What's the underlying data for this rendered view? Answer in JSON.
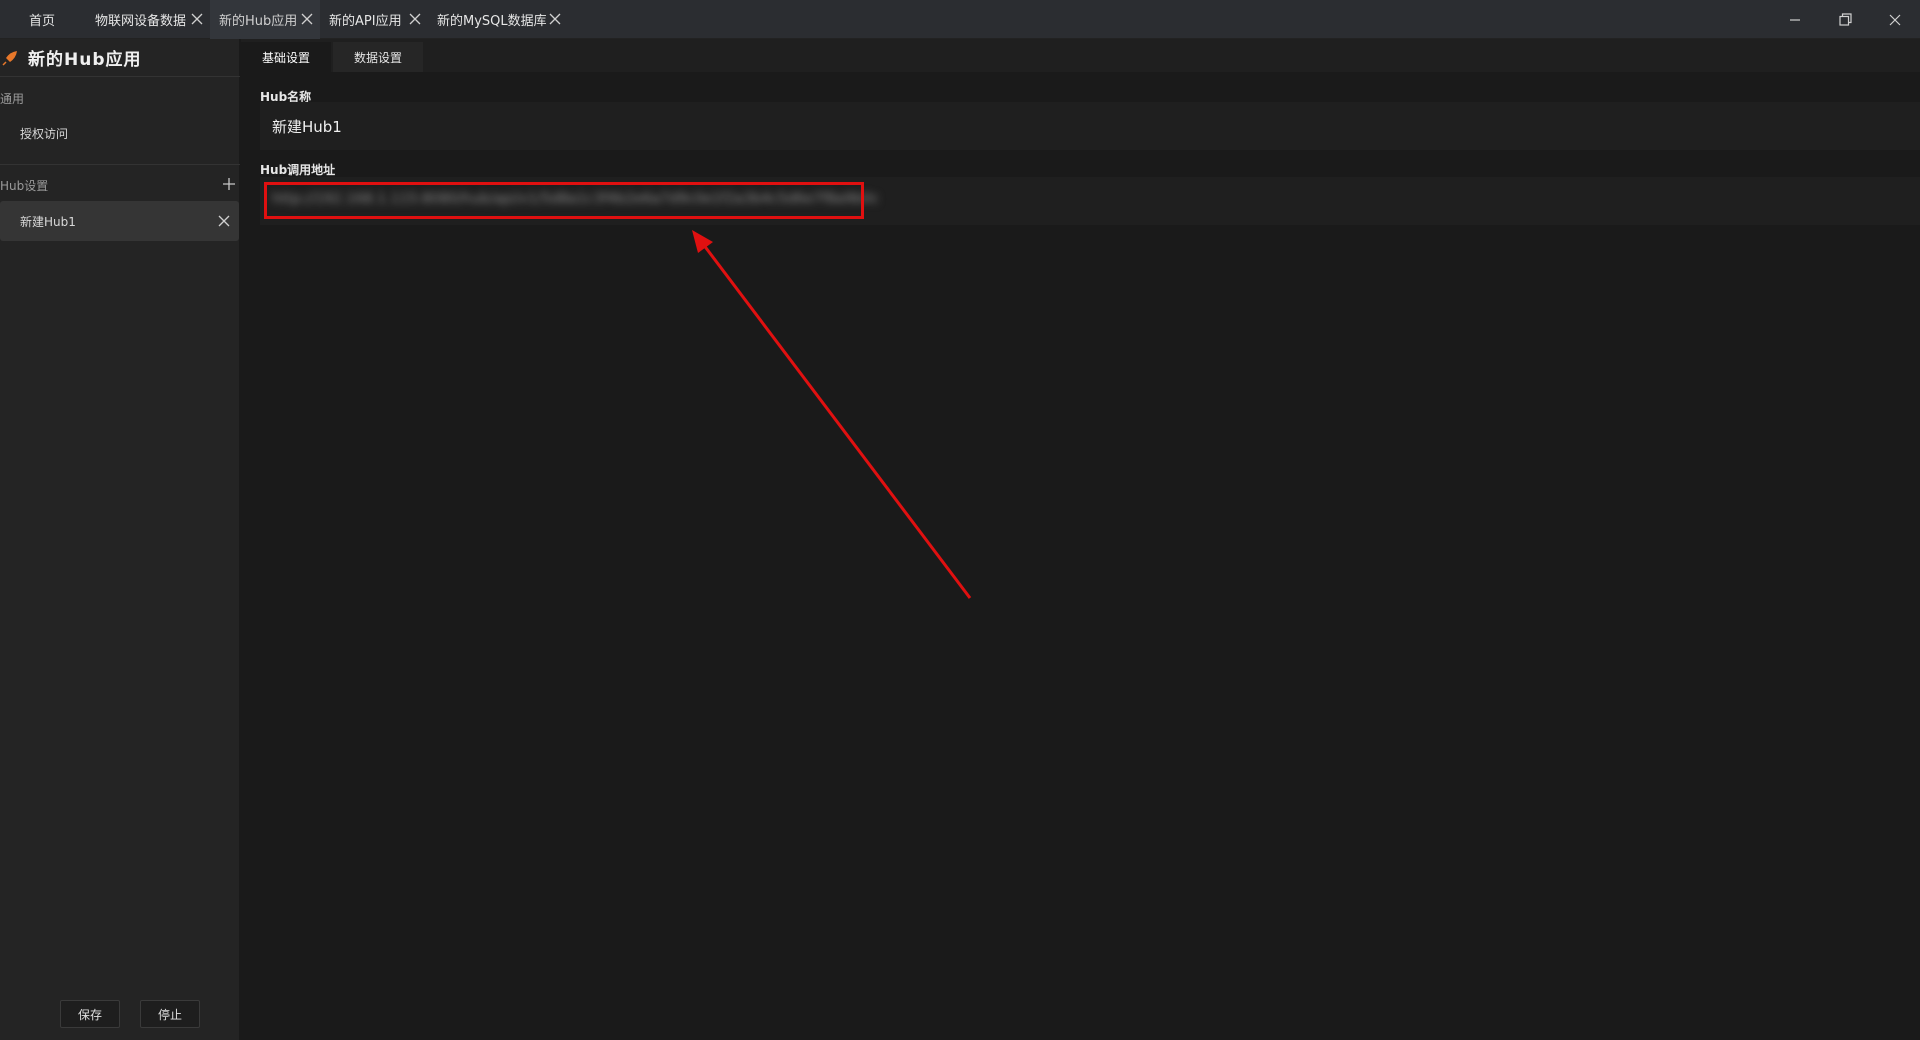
{
  "top_tabs": [
    {
      "label": "首页",
      "closable": false,
      "active": false
    },
    {
      "label": "物联网设备数据",
      "closable": true,
      "active": false
    },
    {
      "label": "新的Hub应用",
      "closable": true,
      "active": true
    },
    {
      "label": "新的API应用",
      "closable": true,
      "active": false
    },
    {
      "label": "新的MySQL数据库",
      "closable": true,
      "active": false
    }
  ],
  "window_controls": [
    "minimize-icon",
    "restore-icon",
    "close-icon"
  ],
  "sidebar": {
    "app_icon": "rocket-icon",
    "app_title": "新的Hub应用",
    "sections": [
      {
        "title": "通用",
        "items": [
          {
            "label": "授权访问"
          }
        ]
      },
      {
        "title": "Hub设置",
        "add_icon": "plus-icon",
        "items": [
          {
            "label": "新建Hub1",
            "selected": true
          }
        ]
      }
    ],
    "save_label": "保存",
    "stop_label": "停止"
  },
  "main": {
    "tabs": [
      {
        "label": "基础设置",
        "active": true
      },
      {
        "label": "数据设置",
        "active": false
      }
    ],
    "hub_name_label": "Hub名称",
    "hub_name_value": "新建Hub1",
    "hub_url_label": "Hub调用地址",
    "hub_url_value": "http://192.168.1.115:8080/hub/api/v1/5d8a1c3f4b2e6a7d9c0e1f2a3b4c5d6e7f8a9b0c"
  },
  "colors": {
    "annotation_red": "#e01010",
    "app_icon_orange": "#e8782a"
  }
}
